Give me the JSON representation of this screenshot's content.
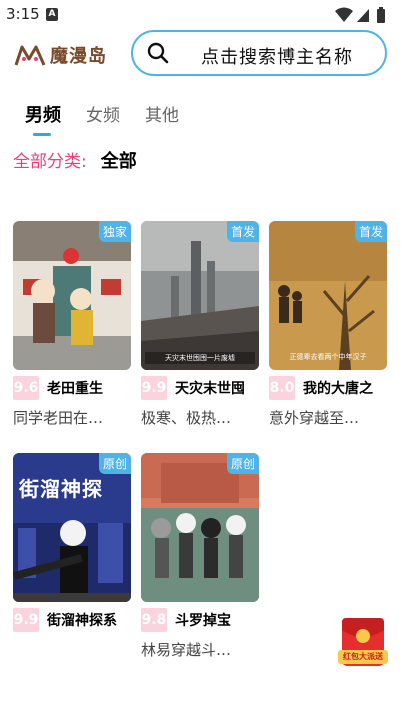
{
  "status_bar": {
    "time": "3:15",
    "notification_letter": "A"
  },
  "header": {
    "logo_text": "魔漫岛",
    "search_placeholder": "点击搜索博主名称"
  },
  "tabs": [
    {
      "label": "男频",
      "active": true
    },
    {
      "label": "女频",
      "active": false
    },
    {
      "label": "其他",
      "active": false
    }
  ],
  "filter": {
    "label": "全部分类:",
    "value": "全部"
  },
  "cards": [
    {
      "badge": "独家",
      "score": "9.6",
      "title": "老田重生",
      "desc": "同学老田在…",
      "cover_caption": ""
    },
    {
      "badge": "首发",
      "score": "9.9",
      "title": "天灾末世囤",
      "desc": "极寒、极热…",
      "cover_caption": "天灾末世囤囤一片废墟"
    },
    {
      "badge": "首发",
      "score": "8.0",
      "title": "我的大唐之",
      "desc": "意外穿越至…",
      "cover_caption": "正德辈去看两个中年汉子"
    },
    {
      "badge": "原创",
      "score": "9.9",
      "title": "街溜神探系",
      "desc": "",
      "cover_caption": "街溜神探"
    },
    {
      "badge": "原创",
      "score": "9.8",
      "title": "斗罗掉宝",
      "desc": "林易穿越斗…",
      "cover_caption": ""
    }
  ],
  "red_packet": {
    "text": "红包大派送"
  }
}
